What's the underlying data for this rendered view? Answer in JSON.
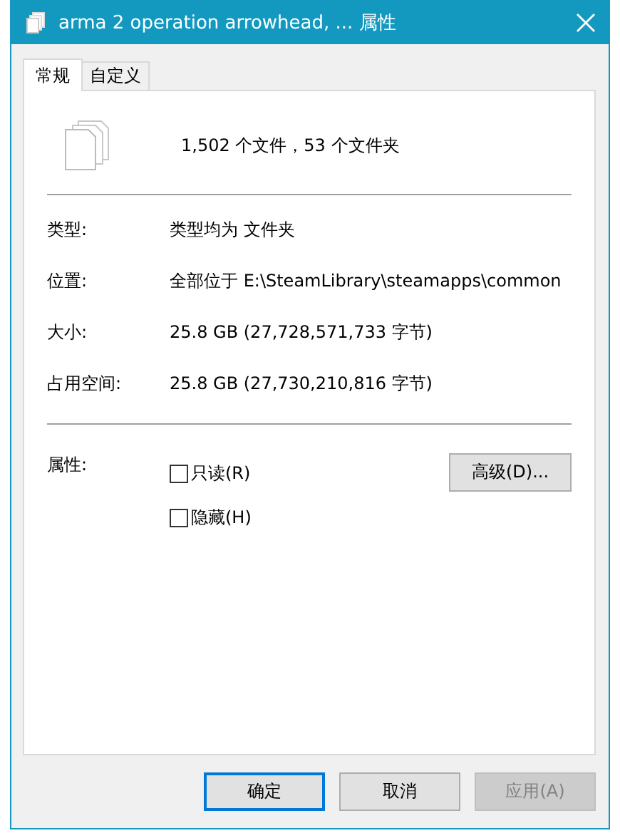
{
  "window": {
    "title": "arma 2 operation arrowhead, ... 属性"
  },
  "tabs": [
    {
      "label": "常规",
      "selected": true
    },
    {
      "label": "自定义",
      "selected": false
    }
  ],
  "summary": "1,502 个文件，53 个文件夹",
  "properties": [
    {
      "label": "类型:",
      "value": "类型均为 文件夹"
    },
    {
      "label": "位置:",
      "value": "全部位于 E:\\SteamLibrary\\steamapps\\common"
    },
    {
      "label": "大小:",
      "value": "25.8 GB (27,728,571,733 字节)"
    },
    {
      "label": "占用空间:",
      "value": "25.8 GB (27,730,210,816 字节)"
    }
  ],
  "attributes": {
    "label": "属性:",
    "advanced_button": "高级(D)...",
    "options": [
      {
        "label": "只读(R)",
        "checked": false
      },
      {
        "label": "隐藏(H)",
        "checked": false
      }
    ]
  },
  "buttons": [
    {
      "label": "确定",
      "default": true,
      "disabled": false
    },
    {
      "label": "取消",
      "default": false,
      "disabled": false
    },
    {
      "label": "应用(A)",
      "default": false,
      "disabled": true
    }
  ]
}
